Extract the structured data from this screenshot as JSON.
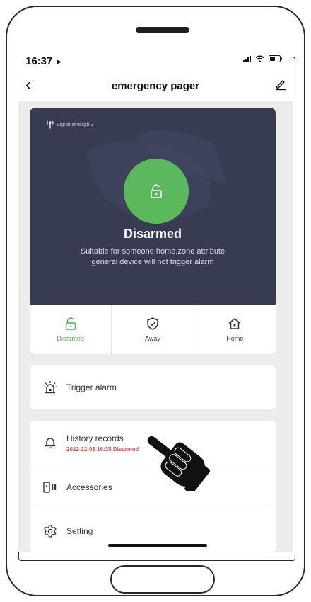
{
  "status_bar": {
    "time": "16:37"
  },
  "nav": {
    "title": "emergency pager"
  },
  "status_card": {
    "signal_label": "Signal strength 3",
    "state_title": "Disarmed",
    "state_desc_line1": "Suitable for someone home,zone attribute",
    "state_desc_line2": "general device will not trigger alarm"
  },
  "modes": [
    {
      "label": "Disarmed",
      "active": true
    },
    {
      "label": "Away",
      "active": false
    },
    {
      "label": "Home",
      "active": false
    }
  ],
  "actions": {
    "trigger_label": "Trigger alarm",
    "history_label": "History records",
    "history_sub": "2022-12-08 16:35 Disarmed",
    "accessories_label": "Accessories",
    "setting_label": "Setting"
  },
  "colors": {
    "card_bg": "#373c53",
    "accent_green": "#5cb85c",
    "history_red": "#d9534f"
  },
  "icons": {
    "signal": "antenna-icon",
    "lock": "unlock-icon",
    "away": "shield-check-icon",
    "home": "home-icon",
    "trigger": "siren-icon",
    "history": "bell-icon",
    "accessories": "devices-icon",
    "setting": "gear-icon"
  }
}
